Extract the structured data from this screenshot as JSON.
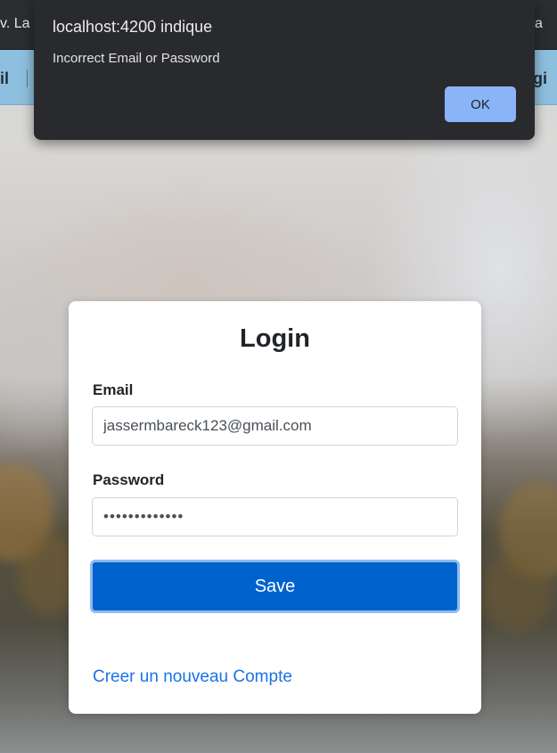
{
  "browser_bar": {
    "left_text": "v. La s",
    "right_text": "a"
  },
  "navbar": {
    "left_item": "il",
    "right_item": "ogi"
  },
  "alert_dialog": {
    "title": "localhost:4200 indique",
    "message": "Incorrect Email or Password",
    "ok_label": "OK"
  },
  "login_form": {
    "title": "Login",
    "email": {
      "label": "Email",
      "value": "jassermbareck123@gmail.com"
    },
    "password": {
      "label": "Password",
      "value": "•••••••••••••"
    },
    "save_label": "Save",
    "create_account_link": "Creer un nouveau Compte"
  },
  "colors": {
    "primary_button": "#0062cc",
    "link": "#1a73e8",
    "dialog_background": "#292a2e",
    "dialog_button": "#8ab4f8",
    "navbar": "#8fbfdf"
  }
}
